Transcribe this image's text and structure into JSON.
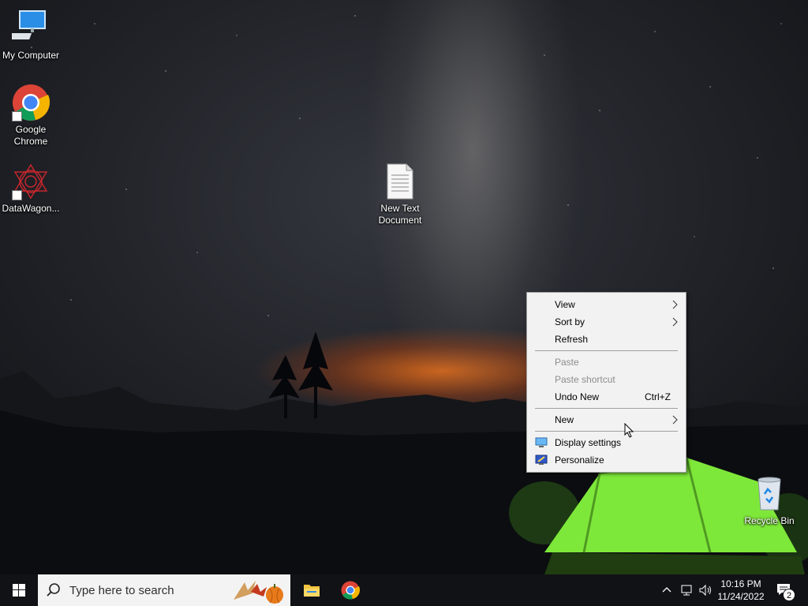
{
  "desktop": {
    "icons": [
      {
        "label": "My Computer",
        "icon": "monitor-icon"
      },
      {
        "label": "Google Chrome",
        "icon": "chrome-icon"
      },
      {
        "label": "DataWagon...",
        "icon": "datawagon-icon"
      },
      {
        "label": "New Text Document",
        "icon": "text-document-icon"
      },
      {
        "label": "Recycle Bin",
        "icon": "recycle-bin-icon"
      }
    ]
  },
  "context_menu": {
    "items": [
      {
        "label": "View",
        "submenu": true,
        "enabled": true
      },
      {
        "label": "Sort by",
        "submenu": true,
        "enabled": true
      },
      {
        "label": "Refresh",
        "enabled": true
      },
      {
        "label": "Paste",
        "enabled": false
      },
      {
        "label": "Paste shortcut",
        "enabled": false
      },
      {
        "label": "Undo New",
        "shortcut": "Ctrl+Z",
        "enabled": true
      },
      {
        "label": "New",
        "submenu": true,
        "enabled": true,
        "hovered": true
      },
      {
        "label": "Display settings",
        "icon": "display-settings-icon",
        "enabled": true
      },
      {
        "label": "Personalize",
        "icon": "personalize-icon",
        "enabled": true
      }
    ]
  },
  "taskbar": {
    "search_placeholder": "Type here to search",
    "apps": [
      {
        "name": "File Explorer",
        "icon": "folder-icon"
      },
      {
        "name": "Google Chrome",
        "icon": "chrome-icon"
      }
    ],
    "clock": {
      "time": "10:16 PM",
      "date": "11/24/2022"
    },
    "notification_count": "2"
  },
  "colors": {
    "menu_bg": "#f2f2f2",
    "menu_hover": "#91c9f7",
    "taskbar_bg": "#101216",
    "tent_green": "#7ee83a",
    "horizon_orange": "#d6681c"
  }
}
